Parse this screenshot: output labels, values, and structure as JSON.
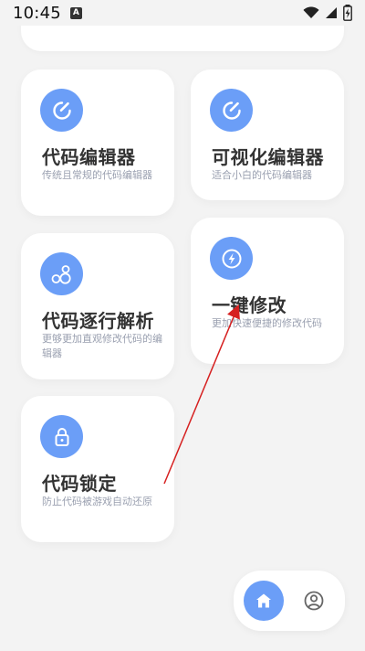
{
  "status_bar": {
    "time": "10:45",
    "notification_icon": "a-square-icon",
    "wifi_icon": "wifi-icon",
    "signal_icon": "signal-icon",
    "battery_icon": "battery-charging-icon"
  },
  "cards": [
    {
      "title": "代码编辑器",
      "description": "传统且常规的代码编辑器",
      "icon": "edit-icon"
    },
    {
      "title": "可视化编辑器",
      "description": "适合小白的代码编辑器",
      "icon": "edit-icon"
    },
    {
      "title": "代码逐行解析",
      "description": "更够更加直观修改代码的编辑器",
      "icon": "bubbles-icon"
    },
    {
      "title": "一键修改",
      "description": "更加快速便捷的修改代码",
      "icon": "lightning-icon"
    },
    {
      "title": "代码锁定",
      "description": "防止代码被游戏自动还原",
      "icon": "lock-icon"
    }
  ],
  "bottom_nav": {
    "home_icon": "home-icon",
    "profile_icon": "profile-icon"
  },
  "colors": {
    "accent": "#6b9ef7",
    "background": "#f3f3f3",
    "card": "#ffffff",
    "title": "#333333",
    "description": "#9aa0b0",
    "annotation_arrow": "#d62020"
  }
}
